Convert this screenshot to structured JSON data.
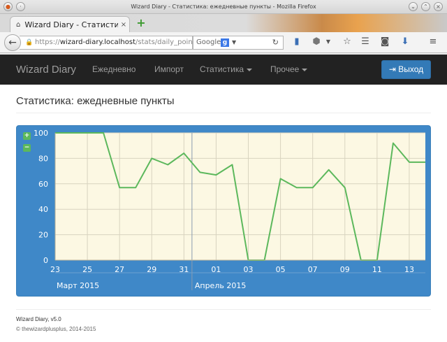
{
  "window": {
    "title": "Wizard Diary - Статистика: ежедневные пункты - Mozilla Firefox",
    "tab_title": "Wizard Diary - Статисти...",
    "tab_close": "×",
    "new_tab": "+",
    "url_scheme": "https://",
    "url_host": "wizard-diary.localhost",
    "url_path": "/stats/daily_points",
    "search_engine": "Google",
    "search_engine_letter": "g",
    "search_arrow": "▼",
    "reload": "↻"
  },
  "icons": {
    "back": "back-arrow-icon",
    "lock": "lock-icon",
    "bookmark": "bookmark-icon",
    "adblock": "adblock-icon",
    "star": "star-icon",
    "reader": "reader-icon",
    "pocket": "pocket-icon",
    "download": "download-icon",
    "menu": "hamburger-menu-icon"
  },
  "site": {
    "brand": "Wizard Diary",
    "nav": [
      "Ежедневно",
      "Импорт",
      "Статистика",
      "Прочее"
    ],
    "logout_label": "Выход"
  },
  "page": {
    "title": "Статистика: ежедневные пункты"
  },
  "chart_controls": {
    "zoom_in": "+",
    "zoom_out": "−"
  },
  "chart_data": {
    "type": "line",
    "x": [
      "2015-03-23",
      "2015-03-24",
      "2015-03-25",
      "2015-03-26",
      "2015-03-27",
      "2015-03-28",
      "2015-03-29",
      "2015-03-30",
      "2015-03-31",
      "2015-04-01",
      "2015-04-02",
      "2015-04-03",
      "2015-04-04",
      "2015-04-05",
      "2015-04-06",
      "2015-04-07",
      "2015-04-08",
      "2015-04-09",
      "2015-04-10",
      "2015-04-11",
      "2015-04-12",
      "2015-04-13",
      "2015-04-14",
      "2015-04-15"
    ],
    "y": [
      100,
      100,
      100,
      100,
      57,
      57,
      80,
      75,
      84,
      69,
      67,
      75,
      0,
      0,
      64,
      57,
      57,
      71,
      57,
      0,
      0,
      92,
      77,
      77
    ],
    "ylim": [
      0,
      100
    ],
    "yticks": [
      0,
      20,
      40,
      60,
      80,
      100
    ],
    "xticks": [
      "23",
      "25",
      "27",
      "29",
      "31",
      "01",
      "03",
      "05",
      "07",
      "09",
      "11",
      "13"
    ],
    "months": [
      "Март 2015",
      "Апрель 2015"
    ],
    "grid": true,
    "colors": {
      "line": "#5cb85c",
      "plot_bg": "#fcf8e3",
      "panel_bg": "#3f88c8",
      "grid": "#d8d3bf"
    }
  },
  "footer": {
    "version": "Wizard Diary, v5.0",
    "copyright": "© thewizardplusplus, 2014-2015"
  }
}
